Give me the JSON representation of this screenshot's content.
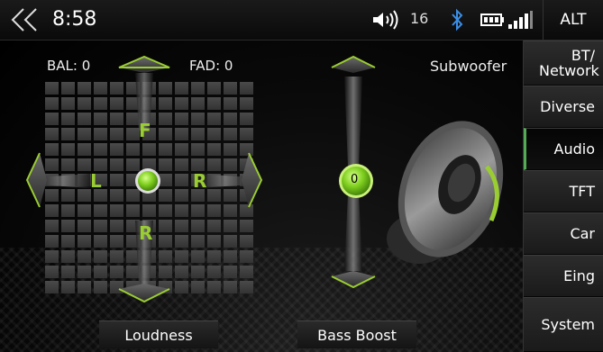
{
  "statusbar": {
    "back_icon": "double-chevron-left-icon",
    "time": "8:58",
    "volume_icon": "speaker-volume-icon",
    "volume": "16",
    "bluetooth_icon": "bluetooth-icon",
    "battery_icon": "battery-icon",
    "signal_icon": "signal-bars-icon",
    "alt_label": "ALT"
  },
  "audio": {
    "bal_label": "BAL: 0",
    "fad_label": "FAD: 0",
    "subwoofer_label": "Subwoofer",
    "front_letter": "F",
    "left_letter": "L",
    "right_letter": "R",
    "rear_letter": "R",
    "subwoofer_level": "0",
    "loudness_label": "Loudness",
    "bass_boost_label": "Bass Boost"
  },
  "sidebar": {
    "items": [
      {
        "label": "BT/ Network"
      },
      {
        "label": "Diverse"
      },
      {
        "label": "Audio"
      },
      {
        "label": "TFT"
      },
      {
        "label": "Car"
      },
      {
        "label": "Eing"
      },
      {
        "label": "System"
      }
    ],
    "active": "Audio"
  },
  "colors": {
    "accent_green": "#9acd32",
    "knob_green": "#7fcf1f"
  }
}
